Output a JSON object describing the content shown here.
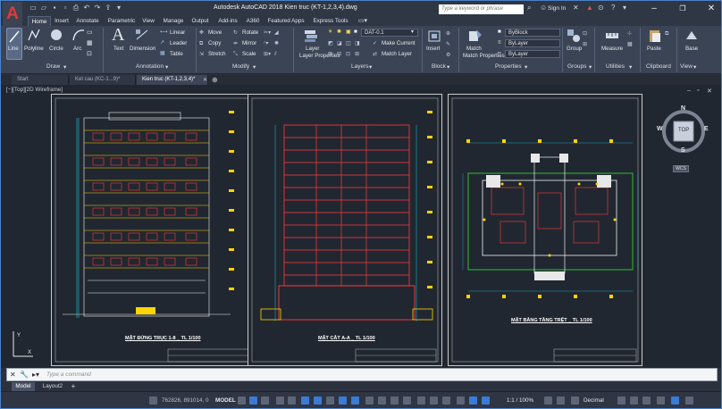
{
  "window": {
    "title": "Autodesk AutoCAD 2018    Kien truc (KT-1,2,3,4).dwg",
    "search_placeholder": "Type a keyword or phrase",
    "sign_in": "Sign In",
    "logo_letter": "A"
  },
  "ribbon_tabs": [
    "Home",
    "Insert",
    "Annotate",
    "Parametric",
    "View",
    "Manage",
    "Output",
    "Add-ins",
    "A360",
    "Featured Apps",
    "Express Tools"
  ],
  "ribbon": {
    "draw": {
      "line": "Line",
      "polyline": "Polyline",
      "circle": "Circle",
      "arc": "Arc",
      "panel": "Draw"
    },
    "annotation": {
      "text": "Text",
      "dimension": "Dimension",
      "linear": "Linear",
      "leader": "Leader",
      "table": "Table",
      "panel": "Annotation"
    },
    "modify": {
      "move": "Move",
      "rotate": "Rotate",
      "copy": "Copy",
      "mirror": "Mirror",
      "stretch": "Stretch",
      "scale": "Scale",
      "panel": "Modify"
    },
    "layers": {
      "layer_properties": "Layer Properties",
      "current_layer": "DAT-0.1",
      "make_current": "Make Current",
      "match_layer": "Match Layer",
      "panel": "Layers"
    },
    "block": {
      "insert": "Insert",
      "panel": "Block"
    },
    "properties": {
      "match_properties": "Match Properties",
      "by_block": "ByBlock",
      "by_layer_1": "ByLayer",
      "by_layer_2": "ByLayer",
      "panel": "Properties"
    },
    "groups": {
      "group": "Group",
      "panel": "Groups"
    },
    "utilities": {
      "measure": "Measure",
      "panel": "Utilities"
    },
    "clipboard": {
      "paste": "Paste",
      "panel": "Clipboard"
    },
    "view": {
      "base": "Base",
      "panel": "View"
    }
  },
  "file_tabs": [
    "Start",
    "Ket cau (KC-1...9)*",
    "Kien truc (KT-1,2,3,4)*"
  ],
  "viewport_label": "[−][Top][2D Wireframe]",
  "drawings": {
    "elevation_caption": "MẶT ĐỨNG TRỤC 1-8 _ TL 1/100",
    "section_caption": "MẶT CẮT A-A _ TL 1/100",
    "plan_caption": "MẶT BẰNG TẦNG TRỆT _ TL 1/100"
  },
  "viewcube": {
    "top": "TOP",
    "north": "N",
    "south": "S",
    "east": "E",
    "west": "W",
    "wcs": "WCS"
  },
  "command_line": {
    "placeholder": "Type a command"
  },
  "layout_tabs": [
    "Model",
    "Layout2"
  ],
  "status": {
    "coordinates": "762826, 891014, 0",
    "model": "MODEL",
    "scale": "1:1 / 100%",
    "units": "Decimal"
  },
  "colors": {
    "accent": "#4a82c8",
    "background": "#212730",
    "ribbon": "#3b4454"
  }
}
